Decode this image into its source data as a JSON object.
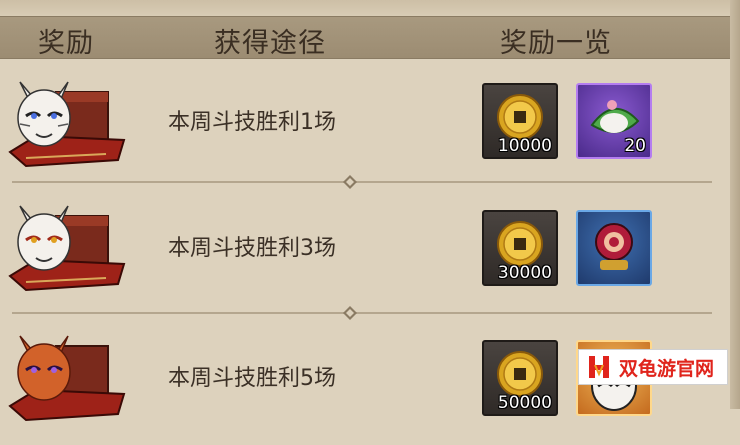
{
  "header": {
    "col_reward": "奖励",
    "col_method": "获得途径",
    "col_overview": "奖励一览"
  },
  "rows": [
    {
      "condition": "本周斗技胜利1场",
      "mask_color": "white",
      "items": [
        {
          "icon": "gold-coin-icon",
          "rarity": "dark",
          "qty": "10000"
        },
        {
          "icon": "leaf-rice-cake-icon",
          "rarity": "purple",
          "qty": "20"
        }
      ]
    },
    {
      "condition": "本周斗技胜利3场",
      "mask_color": "white",
      "items": [
        {
          "icon": "gold-coin-icon",
          "rarity": "dark",
          "qty": "30000"
        },
        {
          "icon": "drum-creature-icon",
          "rarity": "blue",
          "qty": ""
        }
      ]
    },
    {
      "condition": "本周斗技胜利5场",
      "mask_color": "orange",
      "items": [
        {
          "icon": "gold-coin-icon",
          "rarity": "dark",
          "qty": "50000"
        },
        {
          "icon": "daruma-icon",
          "rarity": "orange",
          "qty": ""
        }
      ]
    }
  ],
  "watermark": {
    "logo": "H",
    "text": "双龟游官网"
  },
  "colors": {
    "background": "#ddd2bd",
    "header": "#a08f75",
    "watermark_red": "#e0241c"
  }
}
